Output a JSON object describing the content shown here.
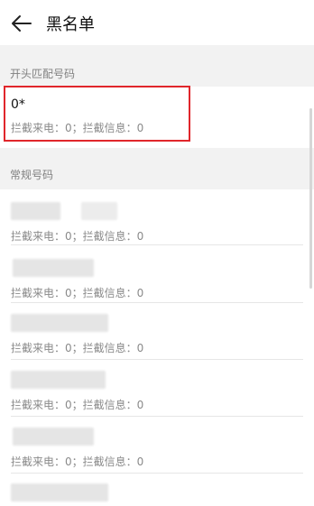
{
  "header": {
    "title": "黑名单",
    "back_icon": "arrow-left-icon"
  },
  "prefix_section": {
    "label": "开头匹配号码",
    "items": [
      {
        "number": "0*",
        "stats": "拦截来电：0；拦截信息：0"
      }
    ]
  },
  "regular_section": {
    "label": "常规号码",
    "items": [
      {
        "number": "",
        "stats": "拦截来电：0；拦截信息：0"
      },
      {
        "number": "",
        "stats": "拦截来电：0；拦截信息：0"
      },
      {
        "number": "",
        "stats": "拦截来电：0；拦截信息：0"
      },
      {
        "number": "",
        "stats": "拦截来电：0；拦截信息：0"
      },
      {
        "number": "",
        "stats": "拦截来电：0；拦截信息：0"
      }
    ]
  },
  "colors": {
    "highlight": "#e0262b",
    "background": "#f2f2f2"
  }
}
